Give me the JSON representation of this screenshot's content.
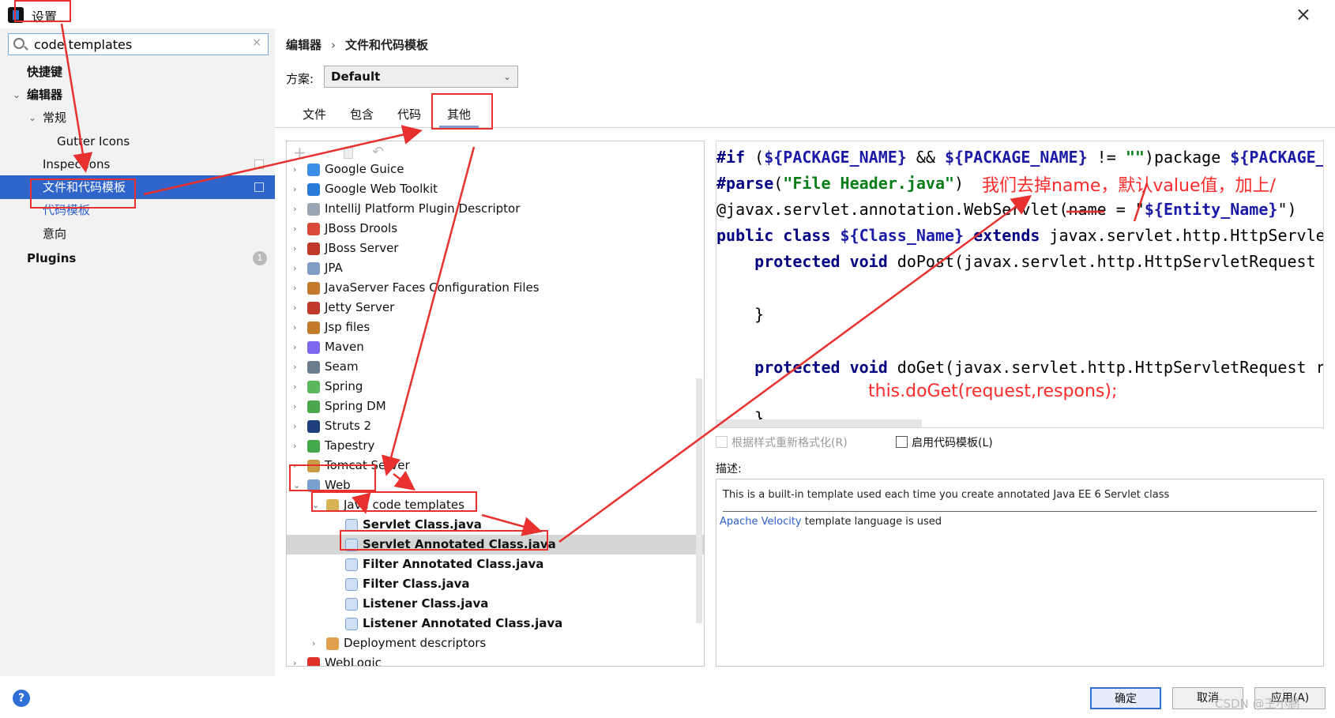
{
  "window": {
    "title": "设置",
    "close_glyph": "×"
  },
  "search": {
    "value": "code templates",
    "clear_glyph": "×"
  },
  "sidebar": {
    "items": [
      {
        "label": "快捷键"
      },
      {
        "label": "编辑器",
        "expanded_glyph": "⌄"
      },
      {
        "label": "常规",
        "expanded_glyph": "⌄"
      },
      {
        "label": "Gutter Icons"
      },
      {
        "label": "Inspections"
      },
      {
        "label": "文件和代码模板"
      },
      {
        "label": "代码模板"
      },
      {
        "label": "意向"
      },
      {
        "label": "Plugins",
        "badge": "1"
      }
    ]
  },
  "breadcrumb": {
    "parent": "编辑器",
    "separator": "›",
    "current": "文件和代码模板"
  },
  "scheme": {
    "label": "方案:",
    "value": "Default",
    "arrow": "⌄"
  },
  "tabs": [
    "文件",
    "包含",
    "代码",
    "其他"
  ],
  "tree": {
    "toolbar": {
      "add": "+",
      "reset": "↶"
    },
    "rows": [
      {
        "label": "Google Guice",
        "icon": "google-guice-icon"
      },
      {
        "label": "Google Web Toolkit",
        "icon": "gwt-icon"
      },
      {
        "label": "IntelliJ Platform Plugin Descriptor",
        "icon": "plugin-descriptor-icon"
      },
      {
        "label": "JBoss Drools",
        "icon": "jboss-drools-icon"
      },
      {
        "label": "JBoss Server",
        "icon": "jboss-server-icon"
      },
      {
        "label": "JPA",
        "icon": "jpa-icon"
      },
      {
        "label": "JavaServer Faces Configuration Files",
        "icon": "jsf-icon"
      },
      {
        "label": "Jetty Server",
        "icon": "jetty-icon"
      },
      {
        "label": "Jsp files",
        "icon": "jsp-icon"
      },
      {
        "label": "Maven",
        "icon": "maven-icon"
      },
      {
        "label": "Seam",
        "icon": "seam-icon"
      },
      {
        "label": "Spring",
        "icon": "spring-icon"
      },
      {
        "label": "Spring DM",
        "icon": "spring-dm-icon"
      },
      {
        "label": "Struts 2",
        "icon": "struts-icon"
      },
      {
        "label": "Tapestry",
        "icon": "tapestry-icon"
      },
      {
        "label": "Tomcat Server",
        "icon": "tomcat-icon"
      },
      {
        "label": "Web",
        "icon": "web-icon"
      },
      {
        "label": "Java code templates",
        "icon": "folder-icon"
      },
      {
        "label": "Servlet Class.java",
        "icon": "file-template-icon"
      },
      {
        "label": "Servlet Annotated Class.java",
        "icon": "file-template-icon"
      },
      {
        "label": "Filter Annotated Class.java",
        "icon": "file-template-icon"
      },
      {
        "label": "Filter Class.java",
        "icon": "file-template-icon"
      },
      {
        "label": "Listener Class.java",
        "icon": "file-template-icon"
      },
      {
        "label": "Listener Annotated Class.java",
        "icon": "file-template-icon"
      },
      {
        "label": "Deployment descriptors",
        "icon": "xml-icon"
      },
      {
        "label": "WebLogic",
        "icon": "weblogic-icon"
      }
    ]
  },
  "code": {
    "l1": {
      "a": "#if",
      "b": " (",
      "c": "${PACKAGE_NAME}",
      "d": " && ",
      "e": "${PACKAGE_NAME}",
      "f": " != ",
      "g": "\"\"",
      "h": ")package ",
      "i": "${PACKAGE_NAME}"
    },
    "l2": {
      "a": "#parse",
      "b": "(",
      "c": "\"File Header.java\"",
      "d": ")"
    },
    "l3": {
      "a": "@javax.servlet.annotation.WebServlet(name = \"",
      "b": "${Entity_Name}",
      "c": "\")"
    },
    "l4": {
      "a": "public class ",
      "b": "${Class_Name}",
      "c": " extends ",
      "d": "javax.servlet.http.HttpServlet"
    },
    "l5": {
      "a": "    protected void ",
      "b": "doPost(javax.servlet.http.HttpServletRequest"
    },
    "l6": "    }",
    "l7": {
      "a": "    protected void ",
      "b": "doGet(javax.servlet.http.HttpServletRequest r"
    },
    "l8": "    }"
  },
  "annotations": {
    "note1": "我们去掉name，默认value值，加上/",
    "note2": "this.doGet(request,respons);"
  },
  "options": {
    "reformat": "根据样式重新格式化(R)",
    "live_templates": "启用代码模板(L)"
  },
  "description": {
    "label": "描述:",
    "line1": "This is a built-in template used each time you create annotated Java EE 6 Servlet class",
    "link": "Apache Velocity",
    "line2_rest": " template language is used"
  },
  "buttons": {
    "ok": "确定",
    "cancel": "取消",
    "apply": "应用(A)"
  },
  "help_glyph": "?",
  "watermark": "CSDN @王小鹏",
  "colors": {
    "selection": "#2f65ca",
    "annotation": "#e8312f",
    "keyword": "#000080",
    "string": "#067d17"
  }
}
